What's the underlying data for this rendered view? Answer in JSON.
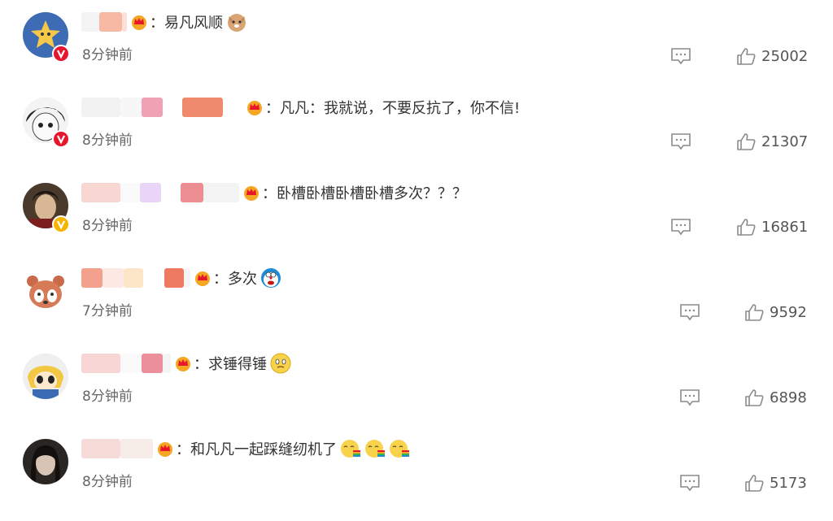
{
  "comments": [
    {
      "sep": "：",
      "text": "易凡风顺",
      "time": "8分钟前",
      "likes": "25002"
    },
    {
      "sep": "：",
      "text": "凡凡：我就说，不要反抗了，你不信!",
      "time": "8分钟前",
      "likes": "21307"
    },
    {
      "sep": "：",
      "text": "卧槽卧槽卧槽卧槽多次？？？",
      "time": "8分钟前",
      "likes": "16861"
    },
    {
      "sep": "：",
      "text": "多次",
      "time": "7分钟前",
      "likes": "9592"
    },
    {
      "sep": "：",
      "text": "求锤得锤",
      "time": "8分钟前",
      "likes": "6898"
    },
    {
      "sep": "：",
      "text": "和凡凡一起踩缝纫机了",
      "time": "8分钟前",
      "likes": "5173"
    }
  ],
  "colors": {
    "verified_red": "#e6162d",
    "verified_yellow": "#f7b500",
    "crown": "#f5a623",
    "icon_gray": "#8a8a8a"
  },
  "icons": {
    "reply": "comment-icon",
    "like": "thumbs-up-icon",
    "crown": "member-crown-icon"
  }
}
